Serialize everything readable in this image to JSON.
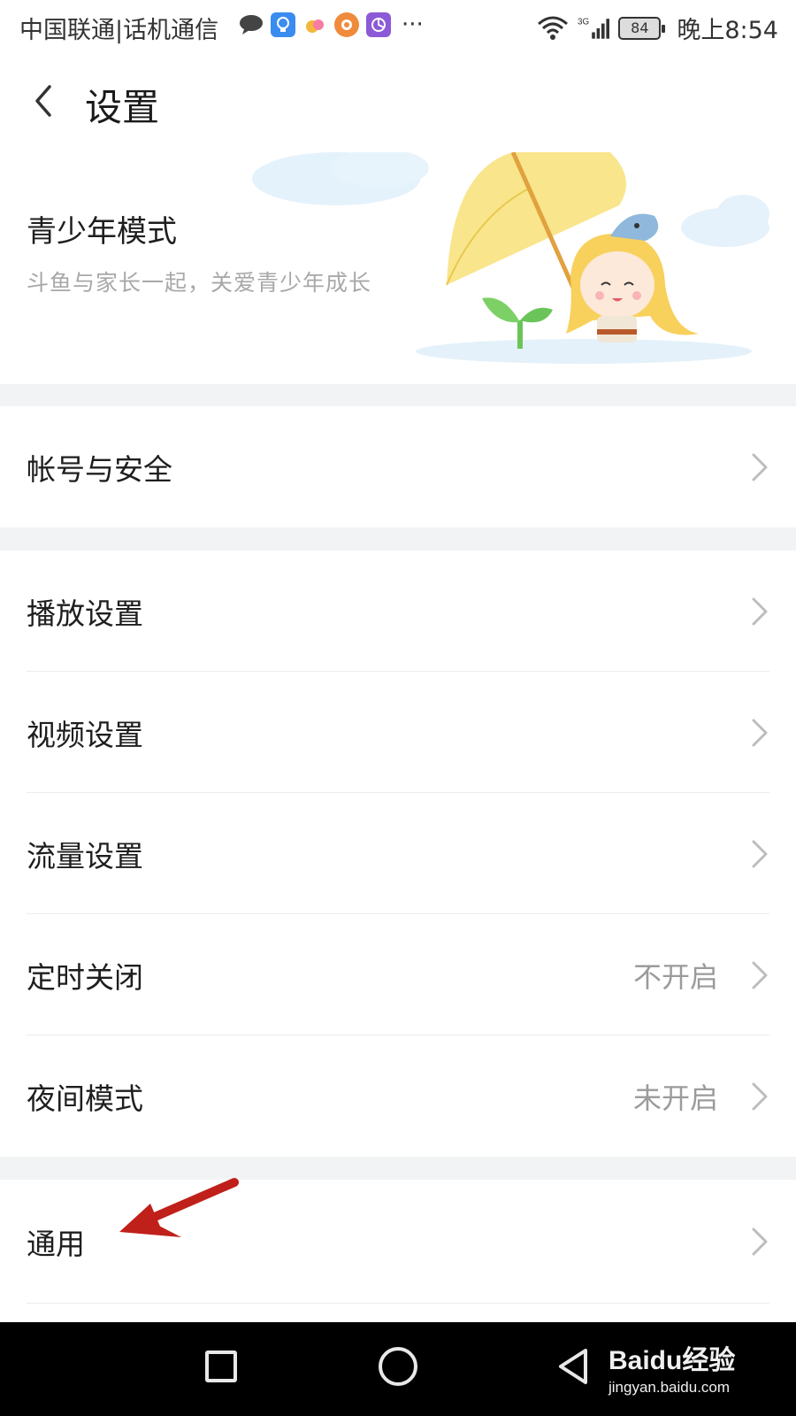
{
  "status_bar": {
    "carrier": "中国联通|话机通信",
    "network": "3G",
    "battery": "84",
    "time": "晚上8:54"
  },
  "header": {
    "title": "设置"
  },
  "banner": {
    "title": "青少年模式",
    "subtitle": "斗鱼与家长一起，关爱青少年成长"
  },
  "sections": {
    "account": {
      "label": "帐号与安全"
    },
    "playback": {
      "label": "播放设置"
    },
    "video": {
      "label": "视频设置"
    },
    "traffic": {
      "label": "流量设置"
    },
    "timer": {
      "label": "定时关闭",
      "value": "不开启"
    },
    "night": {
      "label": "夜间模式",
      "value": "未开启"
    },
    "general": {
      "label": "通用"
    }
  },
  "watermark": {
    "brand": "Baidu经验",
    "url": "jingyan.baidu.com"
  },
  "colors": {
    "background": "#ffffff",
    "section_gap": "#f1f3f4",
    "secondary_text": "#9b9b9b",
    "annotation_arrow": "#c0201a",
    "nav_bar": "#000000"
  }
}
